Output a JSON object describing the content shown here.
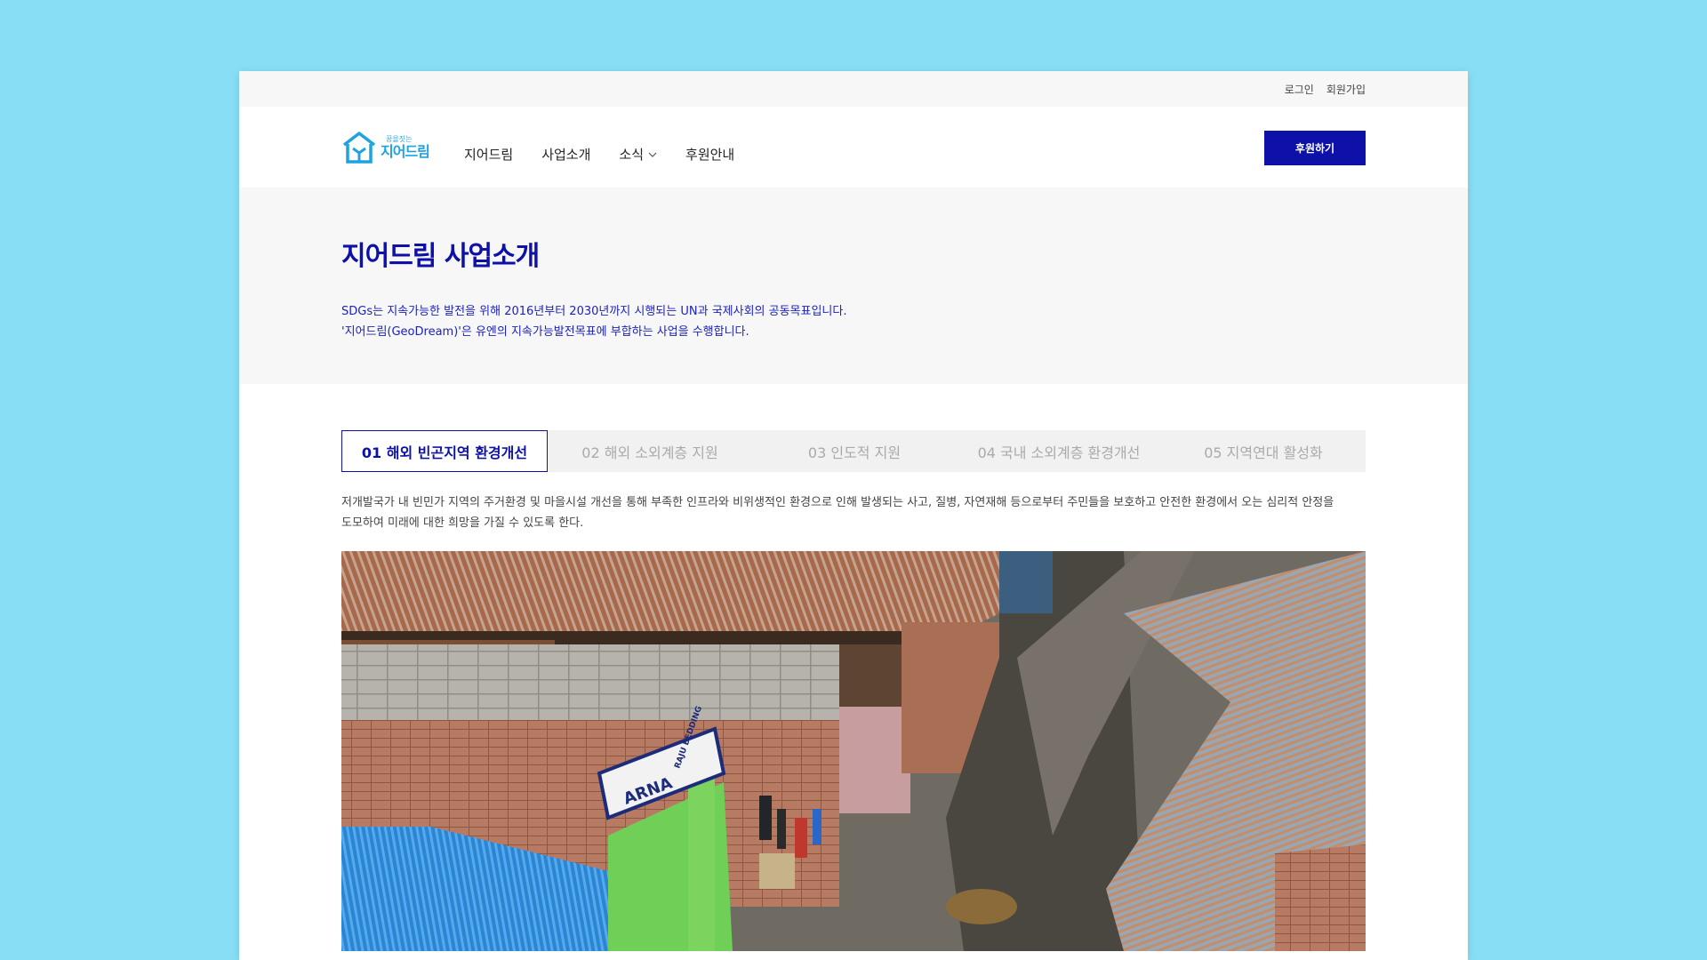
{
  "util": {
    "login": "로그인",
    "signup": "회원가입"
  },
  "logo": {
    "tagline": "꿈을짓는",
    "name": "지어드림"
  },
  "nav": {
    "items": [
      {
        "label": "지어드림"
      },
      {
        "label": "사업소개"
      },
      {
        "label": "소식"
      },
      {
        "label": "후원안내"
      }
    ],
    "donate": "후원하기"
  },
  "hero": {
    "title": "지어드림 사업소개",
    "line1": "SDGs는 지속가능한 발전을 위해 2016년부터 2030년까지 시행되는 UN과 국제사회의 공동목표입니다.",
    "line2": "'지어드림(GeoDream)'은 유엔의 지속가능발전목표에 부합하는 사업을 수행합니다."
  },
  "tabs": [
    {
      "label": "01 해외 빈곤지역 환경개선"
    },
    {
      "label": "02 해외 소외계층 지원"
    },
    {
      "label": "03 인도적 지원"
    },
    {
      "label": "04 국내 소외계층 환경개선"
    },
    {
      "label": "05 지역연대 활성화"
    }
  ],
  "intro": {
    "line1": "저개발국가 내 빈민가 지역의 주거환경 및 마을시설 개선을 통해 부족한 인프라와 비위생적인 환경으로 인해 발생되는 사고, 질병, 자연재해 등으로부터 주민들을 보호하고 안전한 환경에서 오는 심리적 안정을",
    "line2": "도모하여 미래에 대한 희망을 가질 수 있도록 한다."
  },
  "photo": {
    "sign1": "ARNA",
    "sign2": "RAJU BEDDING"
  },
  "colors": {
    "primary": "#0d11a8",
    "logo": "#1fa3e0",
    "background": "#88dff5"
  }
}
